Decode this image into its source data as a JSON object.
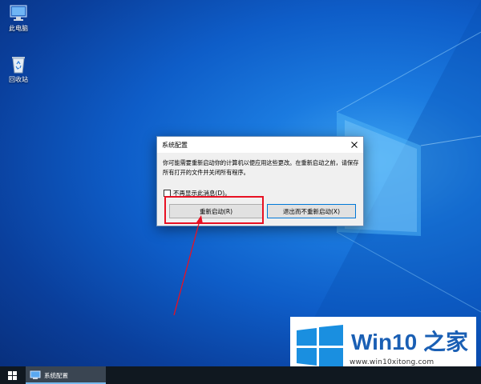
{
  "desktop": {
    "icons": [
      {
        "label": "此电脑",
        "icon": "computer-icon"
      },
      {
        "label": "回收站",
        "icon": "recycle-bin-icon"
      }
    ]
  },
  "dialog": {
    "title": "系统配置",
    "message": "你可能需要重新启动你的计算机以便应用这些更改。在重新启动之前，请保存所有打开的文件并关闭所有程序。",
    "checkbox_label": "不再显示此消息(D)。",
    "checkbox_checked": false,
    "restart_button": "重新启动(R)",
    "exit_button": "退出而不重新启动(X)"
  },
  "taskbar": {
    "start_icon": "windows-logo-icon",
    "active_task_label": "系统配置"
  },
  "watermark": {
    "brand": "Win10 之家",
    "url": "www.win10xitong.com"
  },
  "colors": {
    "accent": "#0078d7",
    "annotation": "#e81123",
    "taskbar": "#101820",
    "brand": "#1a5fb4"
  }
}
